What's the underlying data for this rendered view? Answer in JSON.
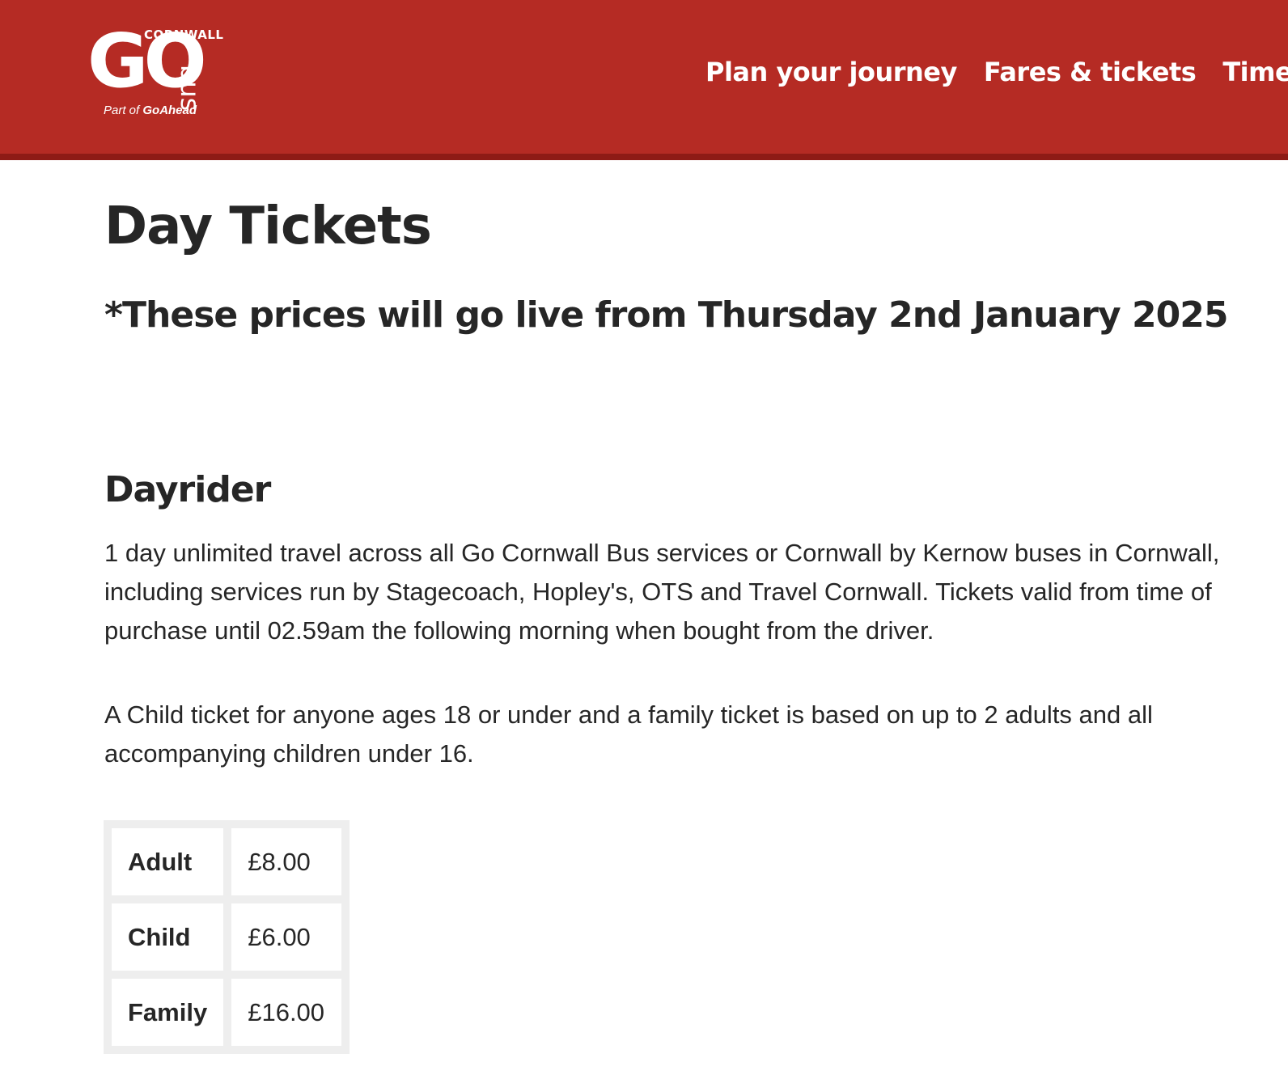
{
  "header": {
    "logo": {
      "cornwall": "CORNWALL",
      "go": "GO",
      "bus": "bus",
      "part_of": "Part of",
      "parent": "GoAhead"
    },
    "nav": [
      {
        "label": "Plan your journey"
      },
      {
        "label": "Fares & tickets"
      },
      {
        "label": "Timetab"
      }
    ],
    "colors": {
      "brand_red": "#b52b24",
      "brand_red_dark": "#8e1b16"
    }
  },
  "main": {
    "title": "Day Tickets",
    "notice": "*These prices will go live from Thursday 2nd January 2025",
    "section": {
      "heading": "Dayrider",
      "paragraphs": [
        "1 day unlimited travel across all Go Cornwall Bus services or Cornwall by Kernow buses in Cornwall, including services run by Stagecoach, Hopley's, OTS and Travel Cornwall. Tickets valid from time of purchase until 02.59am the following morning when bought from the driver.",
        "A Child ticket for anyone ages 18 or under and a family ticket is based on up to 2 adults and all accompanying children under 16."
      ],
      "fares": [
        {
          "type": "Adult",
          "price": "£8.00"
        },
        {
          "type": "Child",
          "price": "£6.00"
        },
        {
          "type": "Family",
          "price": "£16.00"
        }
      ]
    }
  }
}
